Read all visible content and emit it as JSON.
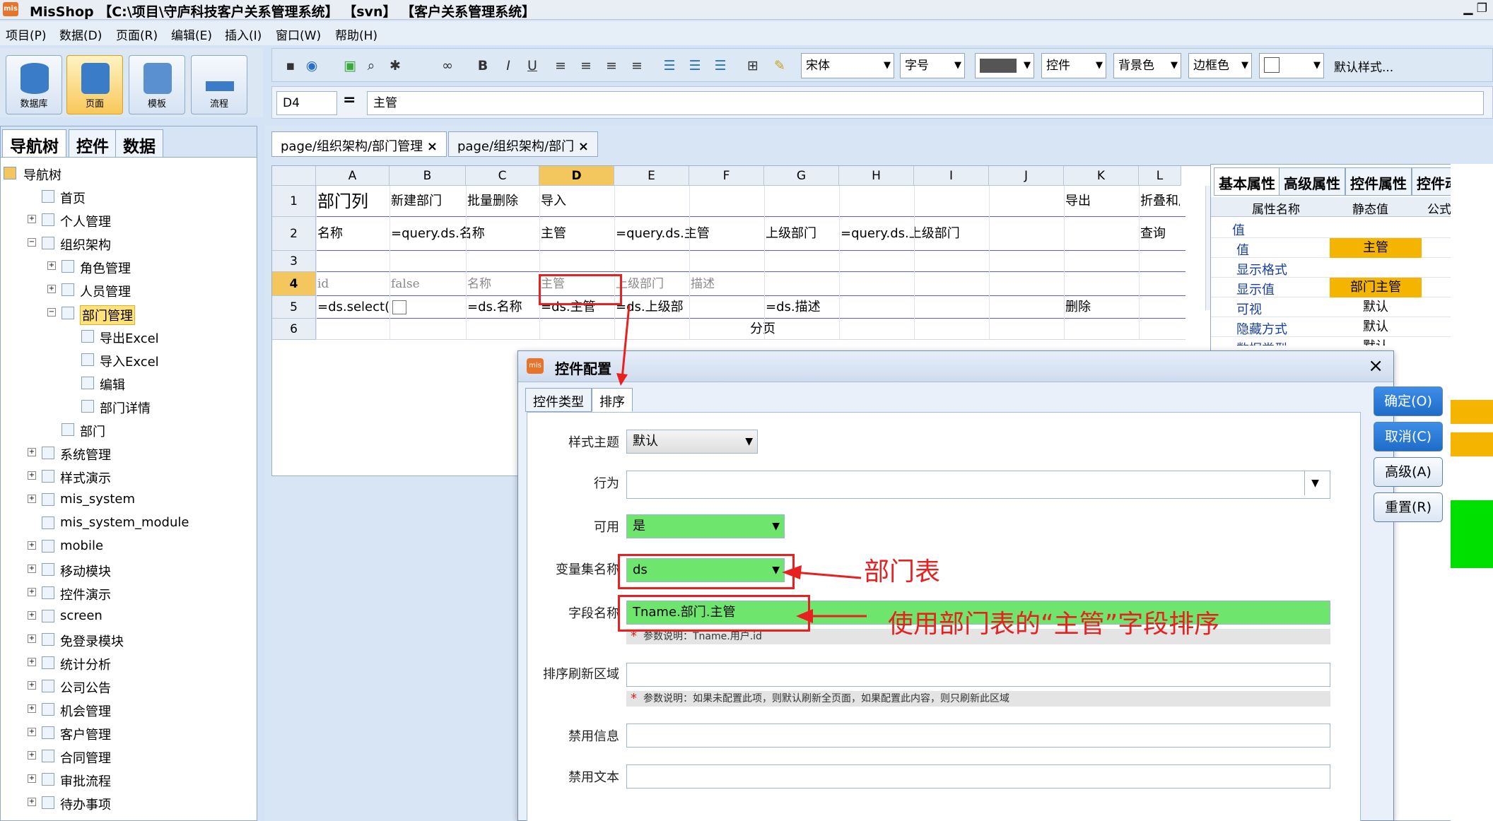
{
  "window": {
    "app_icon": "mis",
    "title": "MisShop 【C:\\项目\\守庐科技客户关系管理系统】 【svn】 【客户关系管理系统】",
    "controls": "▁ ❐"
  },
  "menu": [
    "项目(P)",
    "数据(D)",
    "页面(R)",
    "编辑(E)",
    "插入(I)",
    "窗口(W)",
    "帮助(H)"
  ],
  "big_buttons": [
    {
      "label": "数据库",
      "icon": "database-icon"
    },
    {
      "label": "页面",
      "icon": "page-icon",
      "selected": true
    },
    {
      "label": "模板",
      "icon": "template-icon"
    },
    {
      "label": "流程",
      "icon": "flow-icon"
    }
  ],
  "toolbar": {
    "icons": [
      "save-icon",
      "web-icon",
      "preview-icon",
      "find-icon",
      "tools-icon",
      "binoculars-icon"
    ],
    "bold": "B",
    "italic": "I",
    "underline": "U",
    "font": "宋体",
    "font_size": "字号",
    "control_combo": "控件",
    "bg_combo": "背景色",
    "border_combo": "边框色",
    "default_style": "默认样式..."
  },
  "formula": {
    "cell_ref": "D4",
    "eq": "=",
    "value": "主管"
  },
  "left_tabs": [
    "导航树",
    "控件",
    "数据"
  ],
  "tree": [
    {
      "label": "导航树",
      "level": 0,
      "kind": "root"
    },
    {
      "label": "首页",
      "level": 1
    },
    {
      "label": "个人管理",
      "level": 1,
      "exp": "+"
    },
    {
      "label": "组织架构",
      "level": 1,
      "exp": "−"
    },
    {
      "label": "角色管理",
      "level": 2,
      "exp": "+"
    },
    {
      "label": "人员管理",
      "level": 2,
      "exp": "+"
    },
    {
      "label": "部门管理",
      "level": 2,
      "exp": "−",
      "sel": true
    },
    {
      "label": "导出Excel",
      "level": 3
    },
    {
      "label": "导入Excel",
      "level": 3
    },
    {
      "label": "编辑",
      "level": 3
    },
    {
      "label": "部门详情",
      "level": 3
    },
    {
      "label": "部门",
      "level": 2
    },
    {
      "label": "系统管理",
      "level": 1,
      "exp": "+"
    },
    {
      "label": "样式演示",
      "level": 1,
      "exp": "+"
    },
    {
      "label": "mis_system",
      "level": 1,
      "exp": "+"
    },
    {
      "label": "mis_system_module",
      "level": 1
    },
    {
      "label": "mobile",
      "level": 1,
      "exp": "+"
    },
    {
      "label": "移动模块",
      "level": 1,
      "exp": "+"
    },
    {
      "label": "控件演示",
      "level": 1,
      "exp": "+"
    },
    {
      "label": "screen",
      "level": 1,
      "exp": "+"
    },
    {
      "label": "免登录模块",
      "level": 1,
      "exp": "+"
    },
    {
      "label": "统计分析",
      "level": 1,
      "exp": "+"
    },
    {
      "label": "公司公告",
      "level": 1,
      "exp": "+"
    },
    {
      "label": "机会管理",
      "level": 1,
      "exp": "+"
    },
    {
      "label": "客户管理",
      "level": 1,
      "exp": "+"
    },
    {
      "label": "合同管理",
      "level": 1,
      "exp": "+"
    },
    {
      "label": "审批流程",
      "level": 1,
      "exp": "+"
    },
    {
      "label": "待办事项",
      "level": 1,
      "exp": "+"
    }
  ],
  "doc_tabs": [
    {
      "label": "page/组织架构/部门管理",
      "close": "×"
    },
    {
      "label": "page/组织架构/部门",
      "close": "×"
    }
  ],
  "sheet": {
    "columns": [
      "A",
      "B",
      "C",
      "D",
      "E",
      "F",
      "G",
      "H",
      "I",
      "J",
      "K",
      "L"
    ],
    "rows": [
      "1",
      "2",
      "3",
      "4",
      "5",
      "6"
    ],
    "selected_column": "D",
    "selected_row": "4",
    "cells": {
      "r1": {
        "A": "部门列",
        "B": "新建部门",
        "C": "批量删除",
        "D": "导入",
        "K": "导出",
        "L": "折叠和展"
      },
      "r2": {
        "A": "名称",
        "B": "=query.ds.名称",
        "D": "主管",
        "E": "=query.ds.主管",
        "G": "上级部门",
        "H": "=query.ds.上级部门",
        "L": "查询"
      },
      "r4": {
        "A": "id",
        "B": "false",
        "C": "名称",
        "D": "主管",
        "E": "上级部门",
        "F": "描述"
      },
      "r5": {
        "A": "=ds.select(",
        "C": "=ds.名称",
        "D": "=ds.主管",
        "E": "=ds.上级部",
        "G": "=ds.描述",
        "K": "删除"
      },
      "r6": {
        "G": "分页"
      }
    }
  },
  "props": {
    "tabs": [
      "基本属性",
      "高级属性",
      "控件属性",
      "控件动作"
    ],
    "headers": [
      "属性名称",
      "静态值",
      "公式"
    ],
    "rows": [
      {
        "name": "值",
        "value": "",
        "group": true
      },
      {
        "name": "值",
        "value": "主管",
        "highlight": true
      },
      {
        "name": "显示格式",
        "value": ""
      },
      {
        "name": "显示值",
        "value": "部门主管",
        "highlight": true
      },
      {
        "name": "可视",
        "value": "默认"
      },
      {
        "name": "隐藏方式",
        "value": "默认"
      },
      {
        "name": "数据类型",
        "value": "默认"
      }
    ]
  },
  "dialog": {
    "icon": "mis",
    "title": "控件配置",
    "close": "×",
    "tabs": [
      "控件类型",
      "排序"
    ],
    "fields": {
      "style_theme": {
        "label": "样式主题",
        "value": "默认"
      },
      "behavior": {
        "label": "行为",
        "value": ""
      },
      "enabled": {
        "label": "可用",
        "value": "是"
      },
      "var_set": {
        "label": "变量集名称",
        "value": "ds"
      },
      "field_name": {
        "label": "字段名称",
        "value": "Tname.部门.主管",
        "hint": "参数说明：Tname.用户.id"
      },
      "refresh_area": {
        "label": "排序刷新区域",
        "value": "",
        "hint": "参数说明：如果未配置此项，则默认刷新全页面，如果配置此内容，则只刷新此区域"
      },
      "disabled_info": {
        "label": "禁用信息",
        "value": ""
      },
      "disabled_text": {
        "label": "禁用文本",
        "value": ""
      }
    },
    "buttons": {
      "ok": "确定(O)",
      "cancel": "取消(C)",
      "advanced": "高级(A)",
      "reset": "重置(R)"
    },
    "hint_star": "*"
  },
  "annotations": {
    "var_set": "部门表",
    "field_name": "使用部门表的“主管”字段排序"
  },
  "colors": {
    "accent": "#f5b400",
    "green_field": "#6ee66e",
    "annotation_red": "#e82020",
    "selection": "#f3c75e"
  }
}
